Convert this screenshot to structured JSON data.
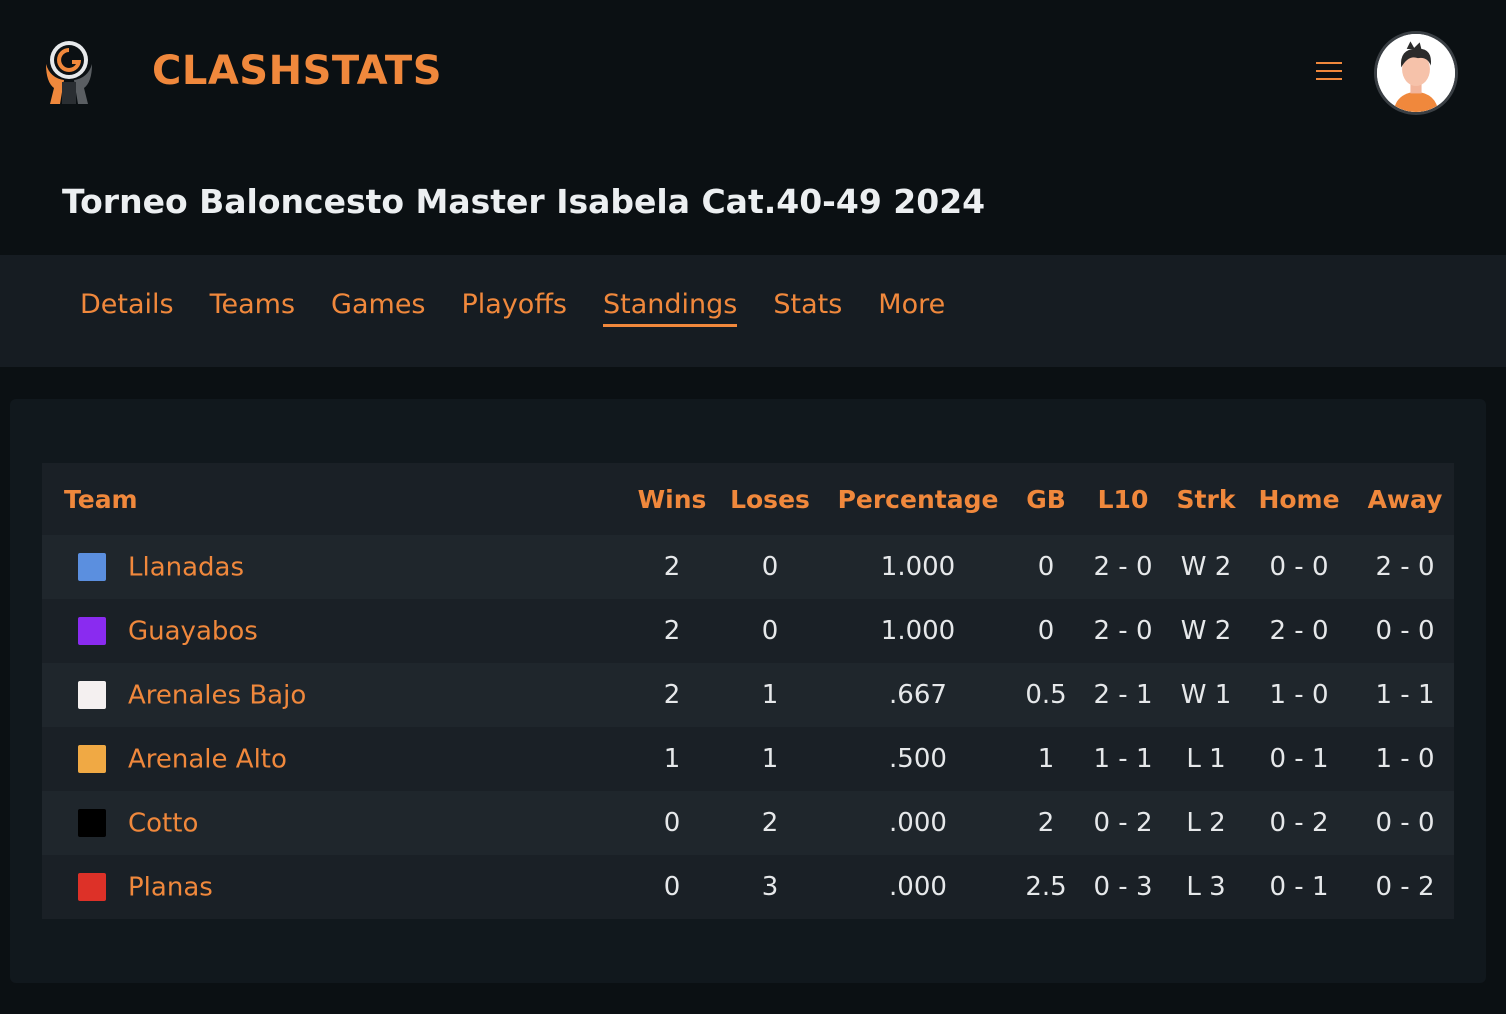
{
  "header": {
    "brand": "CLASHSTATS",
    "accent_color": "#f0883c",
    "menu_icon": "hamburger-menu-icon",
    "avatar_icon": "user-avatar-icon"
  },
  "page": {
    "title": "Torneo Baloncesto Master Isabela Cat.40-49 2024"
  },
  "tabs": [
    {
      "label": "Details",
      "active": false
    },
    {
      "label": "Teams",
      "active": false
    },
    {
      "label": "Games",
      "active": false
    },
    {
      "label": "Playoffs",
      "active": false
    },
    {
      "label": "Standings",
      "active": true
    },
    {
      "label": "Stats",
      "active": false
    },
    {
      "label": "More",
      "active": false
    }
  ],
  "standings": {
    "columns": [
      "Team",
      "Wins",
      "Loses",
      "Percentage",
      "GB",
      "L10",
      "Strk",
      "Home",
      "Away"
    ],
    "rows": [
      {
        "color": "#5b8fdf",
        "team": "Llanadas",
        "wins": "2",
        "loses": "0",
        "pct": "1.000",
        "gb": "0",
        "l10": "2 - 0",
        "strk": "W 2",
        "home": "0 - 0",
        "away": "2 - 0"
      },
      {
        "color": "#8a2bf0",
        "team": "Guayabos",
        "wins": "2",
        "loses": "0",
        "pct": "1.000",
        "gb": "0",
        "l10": "2 - 0",
        "strk": "W 2",
        "home": "2 - 0",
        "away": "0 - 0"
      },
      {
        "color": "#f4f0f0",
        "team": "Arenales Bajo",
        "wins": "2",
        "loses": "1",
        "pct": ".667",
        "gb": "0.5",
        "l10": "2 - 1",
        "strk": "W 1",
        "home": "1 - 0",
        "away": "1 - 1"
      },
      {
        "color": "#f0a944",
        "team": "Arenale Alto",
        "wins": "1",
        "loses": "1",
        "pct": ".500",
        "gb": "1",
        "l10": "1 - 1",
        "strk": "L 1",
        "home": "0 - 1",
        "away": "1 - 0"
      },
      {
        "color": "#000000",
        "team": "Cotto",
        "wins": "0",
        "loses": "2",
        "pct": ".000",
        "gb": "2",
        "l10": "0 - 2",
        "strk": "L 2",
        "home": "0 - 2",
        "away": "0 - 0"
      },
      {
        "color": "#dd3128",
        "team": "Planas",
        "wins": "0",
        "loses": "3",
        "pct": ".000",
        "gb": "2.5",
        "l10": "0 - 3",
        "strk": "L 3",
        "home": "0 - 1",
        "away": "0 - 2"
      }
    ]
  }
}
